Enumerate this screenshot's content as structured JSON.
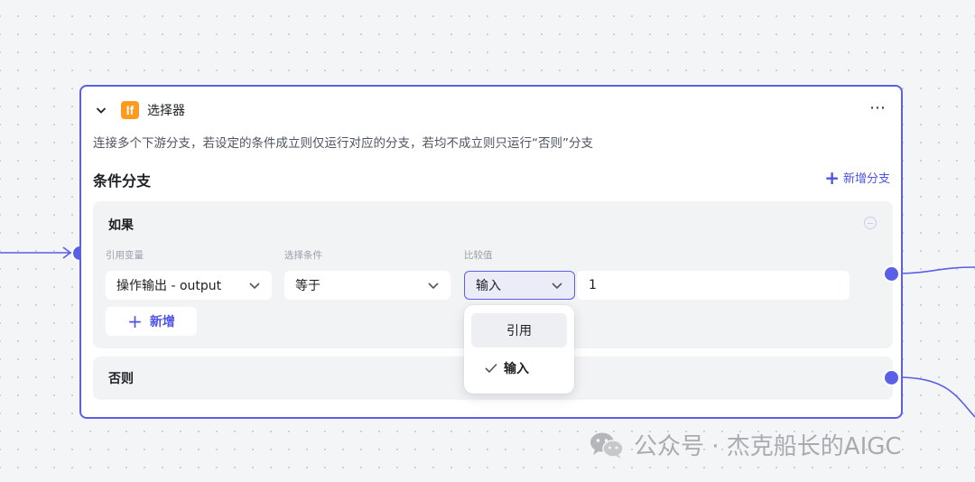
{
  "node": {
    "title": "选择器",
    "icon_text": "If",
    "more_icon": "⋯",
    "description": "连接多个下游分支，若设定的条件成立则仅运行对应的分支，若均不成立则只运行“否则”分支",
    "section_title": "条件分支",
    "add_branch_label": "新增分支"
  },
  "if_branch": {
    "label": "如果",
    "col_ref_label": "引用变量",
    "col_cond_label": "选择条件",
    "col_cmp_label": "比较值",
    "ref_var_value": "操作输出 - output",
    "condition_value": "等于",
    "compare_type_value": "输入",
    "compare_value": "1",
    "add_label": "新增"
  },
  "else_branch": {
    "label": "否则"
  },
  "dropdown": {
    "options": [
      {
        "label": "引用",
        "selected": false
      },
      {
        "label": "输入",
        "selected": true
      }
    ]
  },
  "watermark": {
    "text": "公众号 · 杰克船长的AIGC"
  },
  "colors": {
    "accent": "#4d53e8",
    "border": "#5a5fe6",
    "if_icon": "#ff9a1f"
  }
}
